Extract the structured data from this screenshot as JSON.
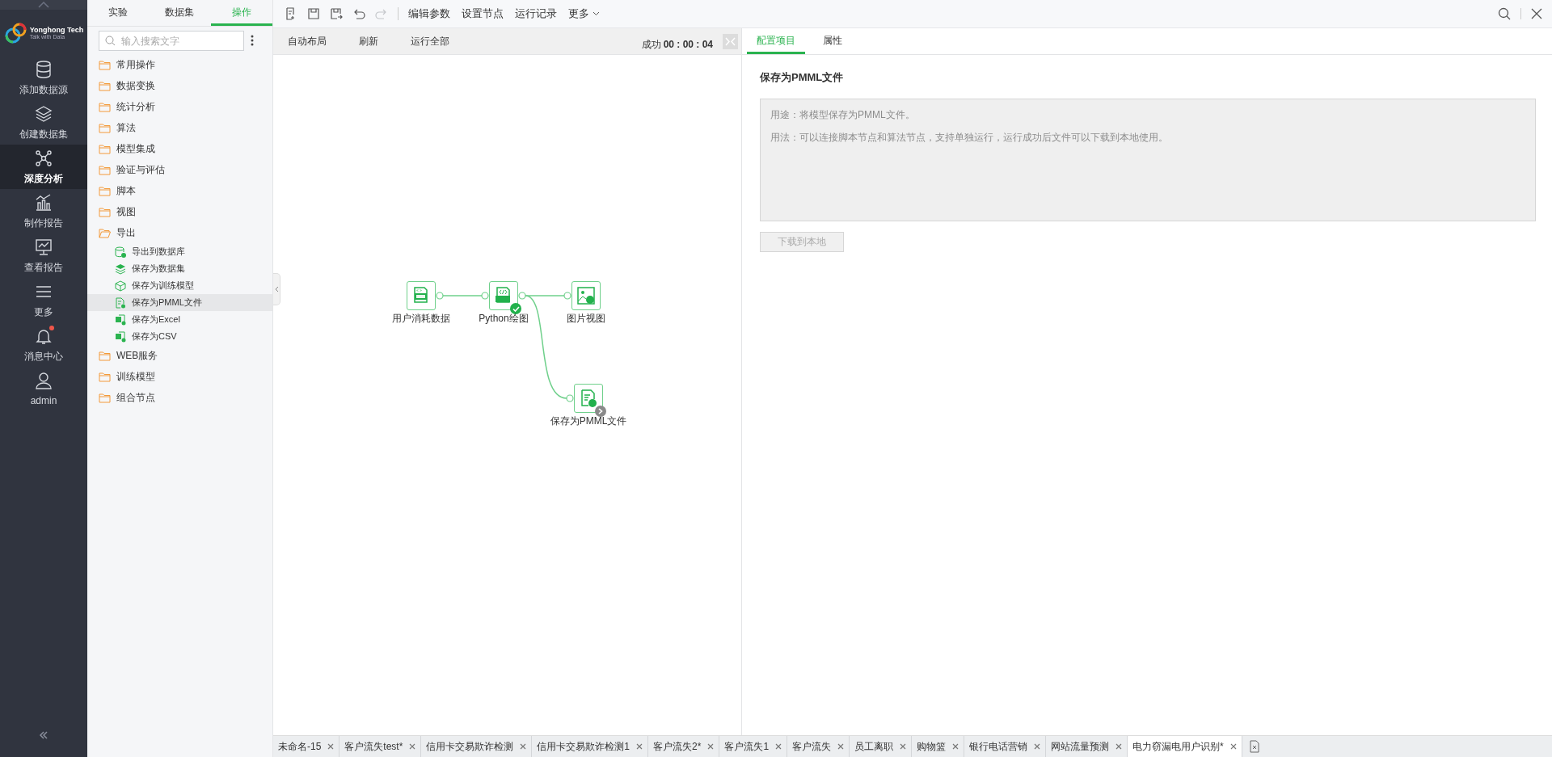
{
  "nav": {
    "brand": "Yonghong Tech",
    "slogan": "Talk with Data",
    "items": [
      {
        "label": "添加数据源",
        "selected": false,
        "has_dot": false
      },
      {
        "label": "创建数据集",
        "selected": false,
        "has_dot": false
      },
      {
        "label": "深度分析",
        "selected": true,
        "has_dot": false
      },
      {
        "label": "制作报告",
        "selected": false,
        "has_dot": false
      },
      {
        "label": "查看报告",
        "selected": false,
        "has_dot": false
      },
      {
        "label": "更多",
        "selected": false,
        "has_dot": false
      },
      {
        "label": "消息中心",
        "selected": false,
        "has_dot": true
      },
      {
        "label": "admin",
        "selected": false,
        "has_dot": false
      }
    ]
  },
  "tree": {
    "tabs": [
      {
        "label": "实验",
        "selected": false
      },
      {
        "label": "数据集",
        "selected": false
      },
      {
        "label": "操作",
        "selected": true
      }
    ],
    "search": {
      "placeholder": "输入搜索文字"
    },
    "items": [
      {
        "label": "常用操作",
        "expanded": false,
        "selected": false
      },
      {
        "label": "数据变换",
        "expanded": false,
        "selected": false
      },
      {
        "label": "统计分析",
        "expanded": false,
        "selected": false
      },
      {
        "label": "算法",
        "expanded": false,
        "selected": false
      },
      {
        "label": "模型集成",
        "expanded": false,
        "selected": false
      },
      {
        "label": "验证与评估",
        "expanded": false,
        "selected": false
      },
      {
        "label": "脚本",
        "expanded": false,
        "selected": false
      },
      {
        "label": "视图",
        "expanded": false,
        "selected": false
      },
      {
        "label": "导出",
        "expanded": true,
        "selected": false,
        "children": [
          {
            "label": "导出到数据库",
            "selected": false
          },
          {
            "label": "保存为数据集",
            "selected": false
          },
          {
            "label": "保存为训练模型",
            "selected": false
          },
          {
            "label": "保存为PMML文件",
            "selected": true
          },
          {
            "label": "保存为Excel",
            "selected": false
          },
          {
            "label": "保存为CSV",
            "selected": false
          }
        ]
      },
      {
        "label": "WEB服务",
        "expanded": false,
        "selected": false
      },
      {
        "label": "训练模型",
        "expanded": false,
        "selected": false
      },
      {
        "label": "组合节点",
        "expanded": false,
        "selected": false
      }
    ]
  },
  "toolbar": {
    "icon_buttons": [
      {
        "disabled": false
      },
      {
        "disabled": false
      },
      {
        "disabled": false
      },
      {
        "disabled": false
      },
      {
        "disabled": true
      }
    ],
    "menus": [
      "编辑参数",
      "设置节点",
      "运行记录",
      "更多"
    ]
  },
  "canvas": {
    "actions": [
      "自动布局",
      "刷新",
      "运行全部"
    ],
    "status": "成功",
    "timer": "00 : 00 : 04",
    "nodes": [
      {
        "label": "用户消耗数据",
        "kind": "sql",
        "succeeded": false,
        "waiting": false
      },
      {
        "label": "Python绘图",
        "kind": "python",
        "succeeded": true,
        "waiting": false
      },
      {
        "label": "图片视图",
        "kind": "image",
        "succeeded": false,
        "waiting": false
      },
      {
        "label": "保存为PMML文件",
        "kind": "pmml",
        "succeeded": false,
        "waiting": true
      }
    ]
  },
  "panel": {
    "tabs": [
      {
        "label": "配置项目",
        "selected": true
      },
      {
        "label": "属性",
        "selected": false
      }
    ],
    "title": "保存为PMML文件",
    "description": [
      "用途：将模型保存为PMML文件。",
      "用法：可以连接脚本节点和算法节点，支持单独运行，运行成功后文件可以下载到本地使用。"
    ],
    "button": {
      "label": "下载到本地",
      "disabled": true
    }
  },
  "bottom_tabs": [
    {
      "label": "未命名-15",
      "selected": false
    },
    {
      "label": "客户流失test*",
      "selected": false
    },
    {
      "label": "信用卡交易欺诈检测",
      "selected": false
    },
    {
      "label": "信用卡交易欺诈检测1",
      "selected": false
    },
    {
      "label": "客户流失2*",
      "selected": false
    },
    {
      "label": "客户流失1",
      "selected": false
    },
    {
      "label": "客户流失",
      "selected": false
    },
    {
      "label": "员工离职",
      "selected": false
    },
    {
      "label": "购物篮",
      "selected": false
    },
    {
      "label": "银行电话营销",
      "selected": false
    },
    {
      "label": "网站流量预测",
      "selected": false
    },
    {
      "label": "电力窃漏电用户识别*",
      "selected": true
    }
  ]
}
